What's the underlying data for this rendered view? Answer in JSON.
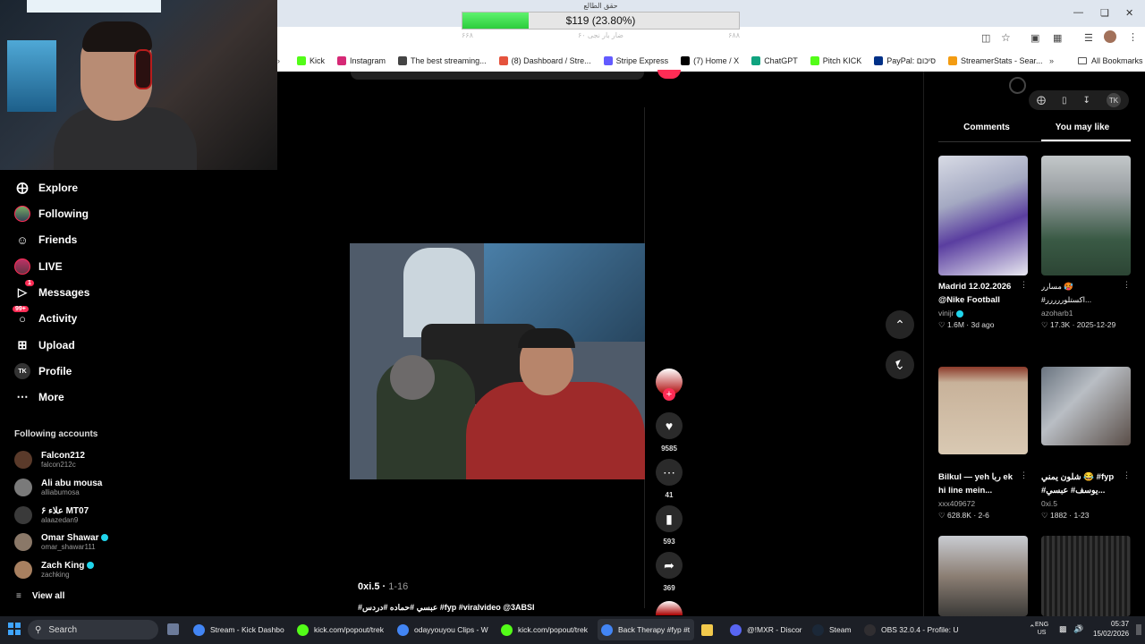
{
  "donation": {
    "title": "حقق الطالع",
    "amount_text": "$119 (23.80%)",
    "progress": 0.238,
    "left_sub": "۶۶۸",
    "mid_sub": "۶۰ ضار بار نجی",
    "right_sub": "۶۸۸"
  },
  "bookmarks": [
    {
      "label": "Kick",
      "color": "#53fc18"
    },
    {
      "label": "Instagram",
      "color": "#d62976"
    },
    {
      "label": "The best streaming...",
      "color": "#444"
    },
    {
      "label": "(8) Dashboard / Stre...",
      "color": "#e5533d"
    },
    {
      "label": "Stripe Express",
      "color": "#635bff"
    },
    {
      "label": "(7) Home / X",
      "color": "#000"
    },
    {
      "label": "ChatGPT",
      "color": "#10a37f"
    },
    {
      "label": "Pitch KICK",
      "color": "#53fc18"
    },
    {
      "label": "PayPal: סיכום",
      "color": "#003087"
    },
    {
      "label": "StreamerStats - Sear...",
      "color": "#f39c12"
    }
  ],
  "all_bookmarks": "All Bookmarks",
  "sidebar": {
    "nav": [
      {
        "label": "Explore",
        "icon": "compass-icon"
      },
      {
        "label": "Following",
        "icon": "following-avatar-icon"
      },
      {
        "label": "Friends",
        "icon": "friends-icon"
      },
      {
        "label": "LIVE",
        "icon": "live-icon"
      },
      {
        "label": "Messages",
        "icon": "messages-icon",
        "badge": "1"
      },
      {
        "label": "Activity",
        "icon": "activity-icon",
        "badge": "99+"
      },
      {
        "label": "Upload",
        "icon": "upload-icon"
      },
      {
        "label": "Profile",
        "icon": "profile-icon"
      },
      {
        "label": "More",
        "icon": "more-icon"
      }
    ],
    "following_title": "Following accounts",
    "accounts": [
      {
        "name": "Falcon212",
        "user": "falcon212c",
        "verified": false
      },
      {
        "name": "Ali abu mousa",
        "user": "alliabumosa",
        "verified": false
      },
      {
        "name": "علاء ۶ MT07",
        "user": "alaazedan9",
        "verified": false
      },
      {
        "name": "Omar Shawar",
        "user": "omar_shawar111",
        "verified": true
      },
      {
        "name": "Zach King",
        "user": "zachking",
        "verified": true
      }
    ],
    "view_all": "View all"
  },
  "video": {
    "author": "0xi.5",
    "date": "1-16",
    "caption": "#عبسي #حماده #دردس #fyp #viralvideo @3ABSI",
    "likes": "9585",
    "comments": "41",
    "saves": "593",
    "shares": "369"
  },
  "right_panel": {
    "tabs": [
      "Comments",
      "You may like"
    ],
    "active_tab": "You may like",
    "cards": [
      {
        "title": "Madrid 12.02.2026",
        "title2": "@Nike Football",
        "user": "vinijr",
        "verified": true,
        "likes": "1.6M",
        "date": "3d ago"
      },
      {
        "title": "مسارر 🥵",
        "title2": "#اكستلوررررر...",
        "user": "azoharb1",
        "verified": false,
        "likes": "17.3K",
        "date": "2025-12-29"
      },
      {
        "title": "Bilkul — yeh ربا ek",
        "title2": "hi line mein...",
        "user": "xxx409672",
        "verified": false,
        "likes": "628.8K",
        "date": "2-6"
      },
      {
        "title": "شلون يمني 😂 #fyp",
        "title2": "#يوسف# عبسي...",
        "user": "0xi.5",
        "verified": false,
        "likes": "1882",
        "date": "1-23"
      }
    ]
  },
  "taskbar": {
    "search": "Search",
    "apps": [
      {
        "label": "Stream - Kick Dashbo",
        "color": "#4285f4"
      },
      {
        "label": "kick.com/popout/trek",
        "color": "#53fc18"
      },
      {
        "label": "odayyouyou Clips - W",
        "color": "#4285f4"
      },
      {
        "label": "kick.com/popout/trek",
        "color": "#53fc18"
      },
      {
        "label": "Back Therapy #fyp #t",
        "color": "#4285f4"
      },
      {
        "label": "",
        "color": "#f2c94c"
      },
      {
        "label": "@!MXR - Discor",
        "color": "#5865f2"
      },
      {
        "label": "Steam",
        "color": "#1b2838"
      },
      {
        "label": "OBS 32.0.4 - Profile: U",
        "color": "#302e31"
      }
    ],
    "lang": "ENG",
    "region": "US",
    "time": "05:37",
    "date": "15/02/2026"
  }
}
